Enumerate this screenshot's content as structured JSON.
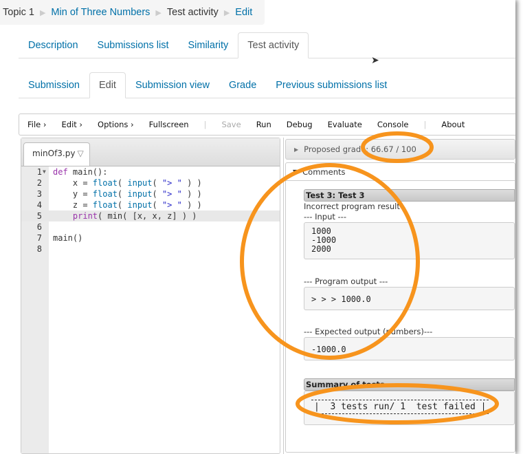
{
  "breadcrumb": [
    {
      "label": "Topic 1",
      "link": false
    },
    {
      "label": "Min of Three Numbers",
      "link": true
    },
    {
      "label": "Test activity",
      "link": false
    },
    {
      "label": "Edit",
      "link": true
    }
  ],
  "tabs_top": [
    {
      "label": "Description",
      "active": false
    },
    {
      "label": "Submissions list",
      "active": false
    },
    {
      "label": "Similarity",
      "active": false
    },
    {
      "label": "Test activity",
      "active": true
    }
  ],
  "tabs_sub": [
    {
      "label": "Submission",
      "active": false
    },
    {
      "label": "Edit",
      "active": true
    },
    {
      "label": "Submission view",
      "active": false
    },
    {
      "label": "Grade",
      "active": false
    },
    {
      "label": "Previous submissions list",
      "active": false
    }
  ],
  "toolbar": {
    "file": "File ›",
    "edit": "Edit ›",
    "options": "Options ›",
    "fullscreen": "Fullscreen",
    "save": "Save",
    "run": "Run",
    "debug": "Debug",
    "evaluate": "Evaluate",
    "console": "Console",
    "about": "About"
  },
  "editor": {
    "filename": "minOf3.py",
    "current_line": 5,
    "lines": [
      "def main():",
      "    x = float( input( \"> \" ) )",
      "    y = float( input( \"> \" ) )",
      "    z = float( input( \"> \" ) )",
      "    print( min( [x, x, z] ) )",
      "",
      "main()",
      ""
    ]
  },
  "grade": {
    "label": "Proposed grade: 66.67 / 100"
  },
  "comments": {
    "label": "Comments",
    "test_title": "Test 3: Test 3",
    "status": "Incorrect program result",
    "input_label": "--- Input ---",
    "input": "1000\n-1000\n2000",
    "output_label": "--- Program output ---",
    "output": "> > > 1000.0",
    "expected_label": "--- Expected output (numbers)---",
    "expected": "-1000.0",
    "summary_title": "Summary of tests",
    "summary": "|  3 tests run/ 1  test failed |"
  },
  "colors": {
    "link": "#0070a8",
    "annotation": "#f7941d"
  }
}
